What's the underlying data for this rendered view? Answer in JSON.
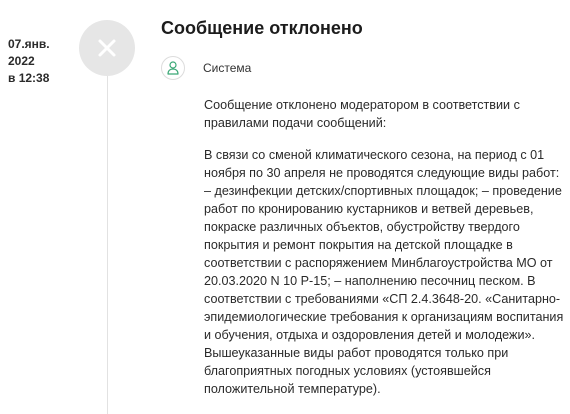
{
  "event": {
    "date_line1": "07.янв.",
    "date_line2": "2022",
    "date_line3": "в 12:38",
    "title": "Сообщение отклонено",
    "status_icon": "close-icon"
  },
  "author": {
    "name": "Система",
    "icon": "user-icon"
  },
  "message": {
    "paragraph1": "Сообщение отклонено модератором в соответствии с правилами подачи сообщений:",
    "paragraph2": "В связи со сменой климатического сезона, на период с 01 ноября по 30 апреля не проводятся следующие виды работ: – дезинфекции детских/спортивных площадок; – проведение работ по кронированию кустарников и ветвей деревьев, покраске различных объектов, обустройству твердого покрытия и ремонт покрытия на детской площадке в соответствии с распоряжением Минблагоустройства МО от 20.03.2020 N 10 Р-15; – наполнению песочниц песком. В соответствии с требованиями «СП 2.4.3648-20. «Санитарно-эпидемиологические требования к организациям воспитания и обучения, отдыха и оздоровления детей и молодежи». Вышеуказанные виды работ проводятся только при благоприятных погодных условиях (устоявшейся положительной температуре)."
  },
  "colors": {
    "status_circle_bg": "#e6e6e6",
    "status_icon": "#ffffff",
    "timeline": "#e2e2e2",
    "avatar_icon": "#3aa876"
  }
}
